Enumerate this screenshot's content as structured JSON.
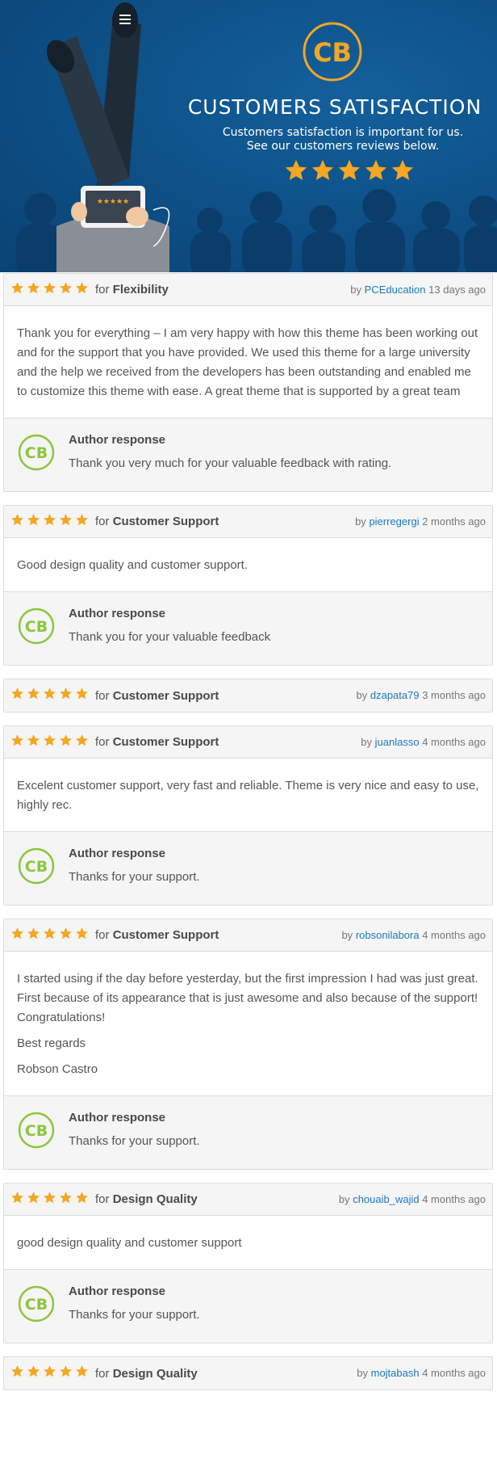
{
  "banner": {
    "title": "CUSTOMERS SATISFACTION",
    "subtitle_line1": "Customers satisfaction is important for us.",
    "subtitle_line2": "See our customers reviews below.",
    "stars": 5,
    "logo": "CB"
  },
  "colors": {
    "banner_bg": "#0d4f85",
    "star": "#f5a623",
    "link": "#1e7ab8",
    "logo_green": "#8cc63f",
    "logo_orange": "#f5a623"
  },
  "labels": {
    "for_word": "for",
    "by_word": "by",
    "author_response": "Author response"
  },
  "reviews": [
    {
      "rating": 5,
      "category": "Flexibility",
      "user": "PCEducation",
      "time": "13 days ago",
      "body": [
        "Thank you for everything – I am very happy with how this theme has been working out and for the support that you have provided. We used this theme for a large university and the help we received from the developers has been outstanding and enabled me to customize this theme with ease. A great theme that is supported by a great team"
      ],
      "response": "Thank you very much for your valuable feedback with rating."
    },
    {
      "rating": 5,
      "category": "Customer Support",
      "user": "pierregergi",
      "time": "2 months ago",
      "body": [
        "Good design quality and customer support."
      ],
      "response": "Thank you for your valuable feedback"
    },
    {
      "rating": 5,
      "category": "Customer Support",
      "user": "dzapata79",
      "time": "3 months ago",
      "body": [],
      "response": null
    },
    {
      "rating": 5,
      "category": "Customer Support",
      "user": "juanlasso",
      "time": "4 months ago",
      "body": [
        "Excelent customer support, very fast and reliable. Theme is very nice and easy to use, highly rec."
      ],
      "response": "Thanks for your support."
    },
    {
      "rating": 5,
      "category": "Customer Support",
      "user": "robsonilabora",
      "time": "4 months ago",
      "body": [
        "I started using if the day before yesterday, but the first impression I had was just great. First because of its appearance that is just awesome and also because of the support! Congratulations!",
        "Best regards",
        "Robson Castro"
      ],
      "response": "Thanks for your support."
    },
    {
      "rating": 5,
      "category": "Design Quality",
      "user": "chouaib_wajid",
      "time": "4 months ago",
      "body": [
        "good design quality and customer support"
      ],
      "response": "Thanks for your support."
    },
    {
      "rating": 5,
      "category": "Design Quality",
      "user": "mojtabash",
      "time": "4 months ago",
      "body": [],
      "response": null
    }
  ]
}
